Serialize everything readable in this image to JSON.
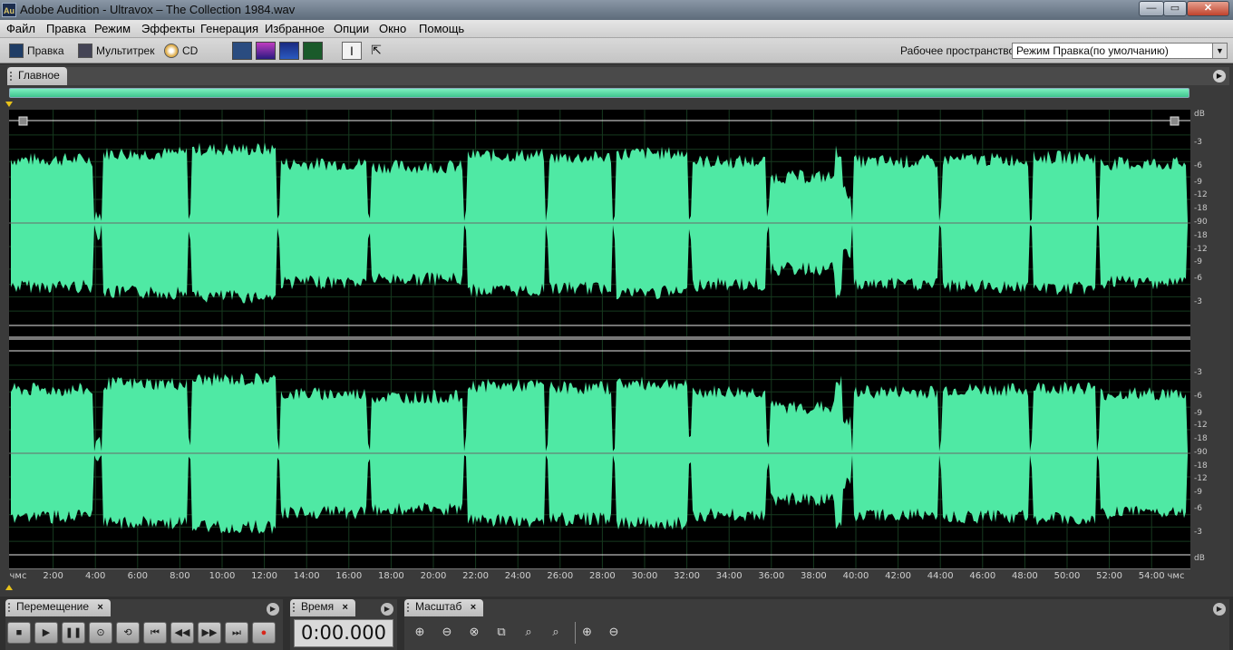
{
  "window": {
    "app_icon_text": "Au",
    "title": "Adobe Audition - Ultravox – The Collection 1984.wav",
    "min_label": "—",
    "max_label": "▭",
    "close_label": "✕"
  },
  "menu": [
    "Файл",
    "Правка",
    "Режим",
    "Эффекты",
    "Генерация",
    "Избранное",
    "Опции",
    "Окно",
    "Помощь"
  ],
  "toolbar": {
    "edit_label": "Правка",
    "multitrack_label": "Мультитрек",
    "cd_label": "CD",
    "workspace_label": "Рабочее пространство:",
    "workspace_value": "Режим Правка(по умолчанию)"
  },
  "main_panel": {
    "tab_label": "Главное"
  },
  "waveform": {
    "color": "#4fe9a4",
    "db_labels_top": [
      "dB",
      "-3",
      "-6",
      "-9",
      "-12",
      "-18",
      "-90",
      "-18",
      "-12",
      "-9",
      "-6",
      "-3"
    ],
    "db_labels_bottom": [
      "-3",
      "-6",
      "-9",
      "-12",
      "-18",
      "-90",
      "-18",
      "-12",
      "-9",
      "-6",
      "-3",
      "dB"
    ],
    "time_labels": [
      "чмс",
      "2:00",
      "4:00",
      "6:00",
      "8:00",
      "10:00",
      "12:00",
      "14:00",
      "16:00",
      "18:00",
      "20:00",
      "22:00",
      "24:00",
      "26:00",
      "28:00",
      "30:00",
      "32:00",
      "34:00",
      "36:00",
      "38:00",
      "40:00",
      "42:00",
      "44:00",
      "46:00",
      "48:00",
      "50:00",
      "52:00",
      "54:00",
      "чмс"
    ]
  },
  "transport_panel": {
    "tab_label": "Перемещение",
    "close_label": "×",
    "buttons": [
      "stop",
      "play",
      "pause",
      "play-to-end",
      "loop",
      "go-to-start",
      "rewind",
      "fast-forward",
      "go-to-end",
      "record"
    ]
  },
  "time_panel": {
    "tab_label": "Время",
    "close_label": "×",
    "value": "0:00.000"
  },
  "zoom_panel": {
    "tab_label": "Масштаб",
    "close_label": "×"
  }
}
